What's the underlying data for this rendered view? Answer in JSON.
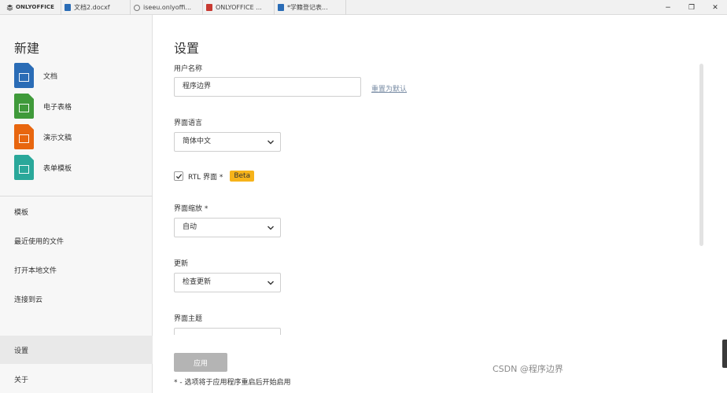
{
  "tabbar": {
    "logo": "ONLYOFFICE",
    "tabs": [
      {
        "label": "文档2.docxf",
        "icon": "document-icon"
      },
      {
        "label": "iseeu.onlyoffi...",
        "icon": "globe-icon"
      },
      {
        "label": "ONLYOFFICE ...",
        "icon": "pdf-icon"
      },
      {
        "label": "*学籍登记表...",
        "icon": "document-icon"
      }
    ],
    "window_controls": {
      "minimize": "−",
      "maximize": "❐",
      "close": "✕"
    }
  },
  "sidebar": {
    "new_title": "新建",
    "new_items": [
      {
        "label": "文档",
        "icon": "document-file-icon"
      },
      {
        "label": "电子表格",
        "icon": "spreadsheet-file-icon"
      },
      {
        "label": "演示文稿",
        "icon": "presentation-file-icon"
      },
      {
        "label": "表单模板",
        "icon": "form-template-file-icon"
      }
    ],
    "nav_items": [
      {
        "label": "模板"
      },
      {
        "label": "最近使用的文件"
      },
      {
        "label": "打开本地文件"
      },
      {
        "label": "连接到云"
      },
      {
        "label": "设置",
        "active": true
      },
      {
        "label": "关于"
      }
    ]
  },
  "main": {
    "title": "设置",
    "username": {
      "label": "用户名称",
      "value": "程序边界",
      "reset_link": "重置为默认"
    },
    "language": {
      "label": "界面语言",
      "value": "简体中文"
    },
    "rtl": {
      "label": "RTL 界面 *",
      "checked": true,
      "badge": "Beta"
    },
    "zoom": {
      "label": "界面缩放 *",
      "value": "自动"
    },
    "update": {
      "label": "更新",
      "value": "检查更新"
    },
    "theme": {
      "label": "界面主题"
    },
    "apply_button": "应用",
    "footnote": "* - 选项将于应用程序重启后开始启用"
  },
  "watermark": "CSDN @程序边界",
  "colors": {
    "accent_badge": "#f6b31a",
    "doc": "#2a6cb6",
    "sheet": "#3f9a3a",
    "slide": "#e8660f",
    "form": "#2aa89a"
  }
}
